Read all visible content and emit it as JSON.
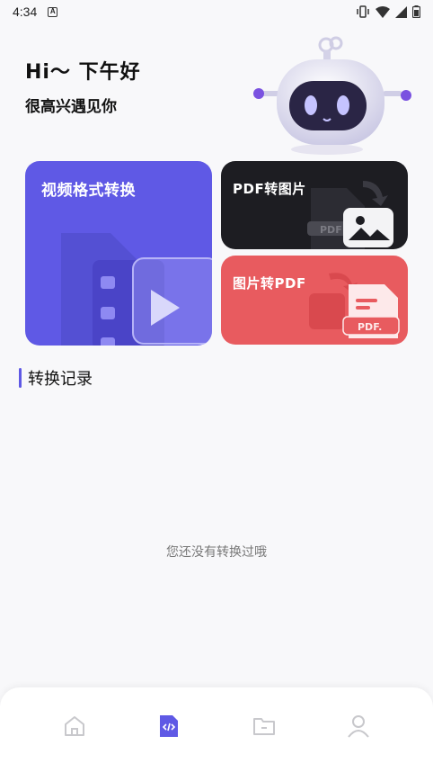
{
  "status_bar": {
    "time": "4:34",
    "badge": "A"
  },
  "greeting": {
    "title": "Hi～ 下午好",
    "subtitle": "很高兴遇见你"
  },
  "cards": {
    "video": {
      "label": "视频格式转换"
    },
    "pdf_to_image": {
      "label": "PDF转图片",
      "badge": "PDF"
    },
    "image_to_pdf": {
      "label": "图片转PDF",
      "badge": "PDF."
    }
  },
  "records": {
    "title": "转换记录",
    "empty": "您还没有转换过哦"
  },
  "nav": {
    "items": [
      {
        "icon": "home-icon",
        "active": false
      },
      {
        "icon": "code-file-icon",
        "active": true
      },
      {
        "icon": "folder-icon",
        "active": false
      },
      {
        "icon": "user-icon",
        "active": false
      }
    ]
  },
  "colors": {
    "accent": "#5f59e5",
    "dark_card": "#1d1d22",
    "red_card": "#e85b5f"
  }
}
